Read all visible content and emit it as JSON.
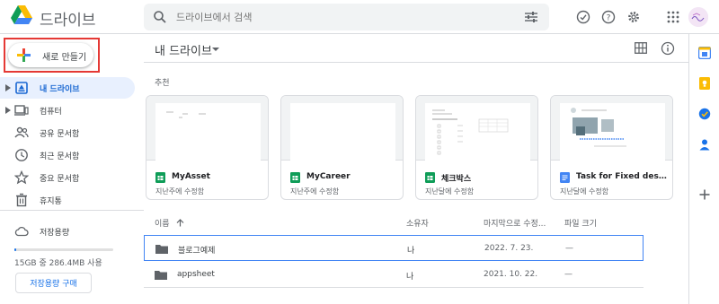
{
  "app": {
    "brand": "드라이브"
  },
  "search": {
    "placeholder": "드라이브에서 검색"
  },
  "sidebar": {
    "new_button": "새로 만들기",
    "items": [
      {
        "label": "내 드라이브"
      },
      {
        "label": "컴퓨터"
      },
      {
        "label": "공유 문서함"
      },
      {
        "label": "최근 문서함"
      },
      {
        "label": "중요 문서함"
      },
      {
        "label": "휴지통"
      }
    ],
    "storage_label": "저장용량",
    "quota_text": "15GB 중 286.4MB 사용",
    "quota_fraction": 0.02,
    "buy_button": "저장용량 구매"
  },
  "main": {
    "title": "내 드라이브",
    "suggested_label": "추천",
    "cards": [
      {
        "name": "MyAsset",
        "sub": "지난주에 수정함",
        "type": "sheets"
      },
      {
        "name": "MyCareer",
        "sub": "지난주에 수정함",
        "type": "sheets"
      },
      {
        "name": "체크박스",
        "sub": "지난달에 수정함",
        "type": "sheets"
      },
      {
        "name": "Task for Fixed desk confir...",
        "sub": "지난달에 수정함",
        "type": "docs"
      }
    ],
    "columns": {
      "name": "이름",
      "owner": "소유자",
      "modified": "마지막으로 수정...",
      "size": "파일 크기"
    },
    "rows": [
      {
        "name": "블로그예제",
        "owner": "나",
        "modified": "2022. 7. 23.",
        "size": "—"
      },
      {
        "name": "appsheet",
        "owner": "나",
        "modified": "2021. 10. 22.",
        "size": "—"
      }
    ]
  },
  "colors": {
    "accent": "#1a73e8",
    "selection": "#e8f0fe",
    "highlight_box": "#e53935",
    "sheets": "#0f9d58",
    "docs": "#4285f4"
  }
}
